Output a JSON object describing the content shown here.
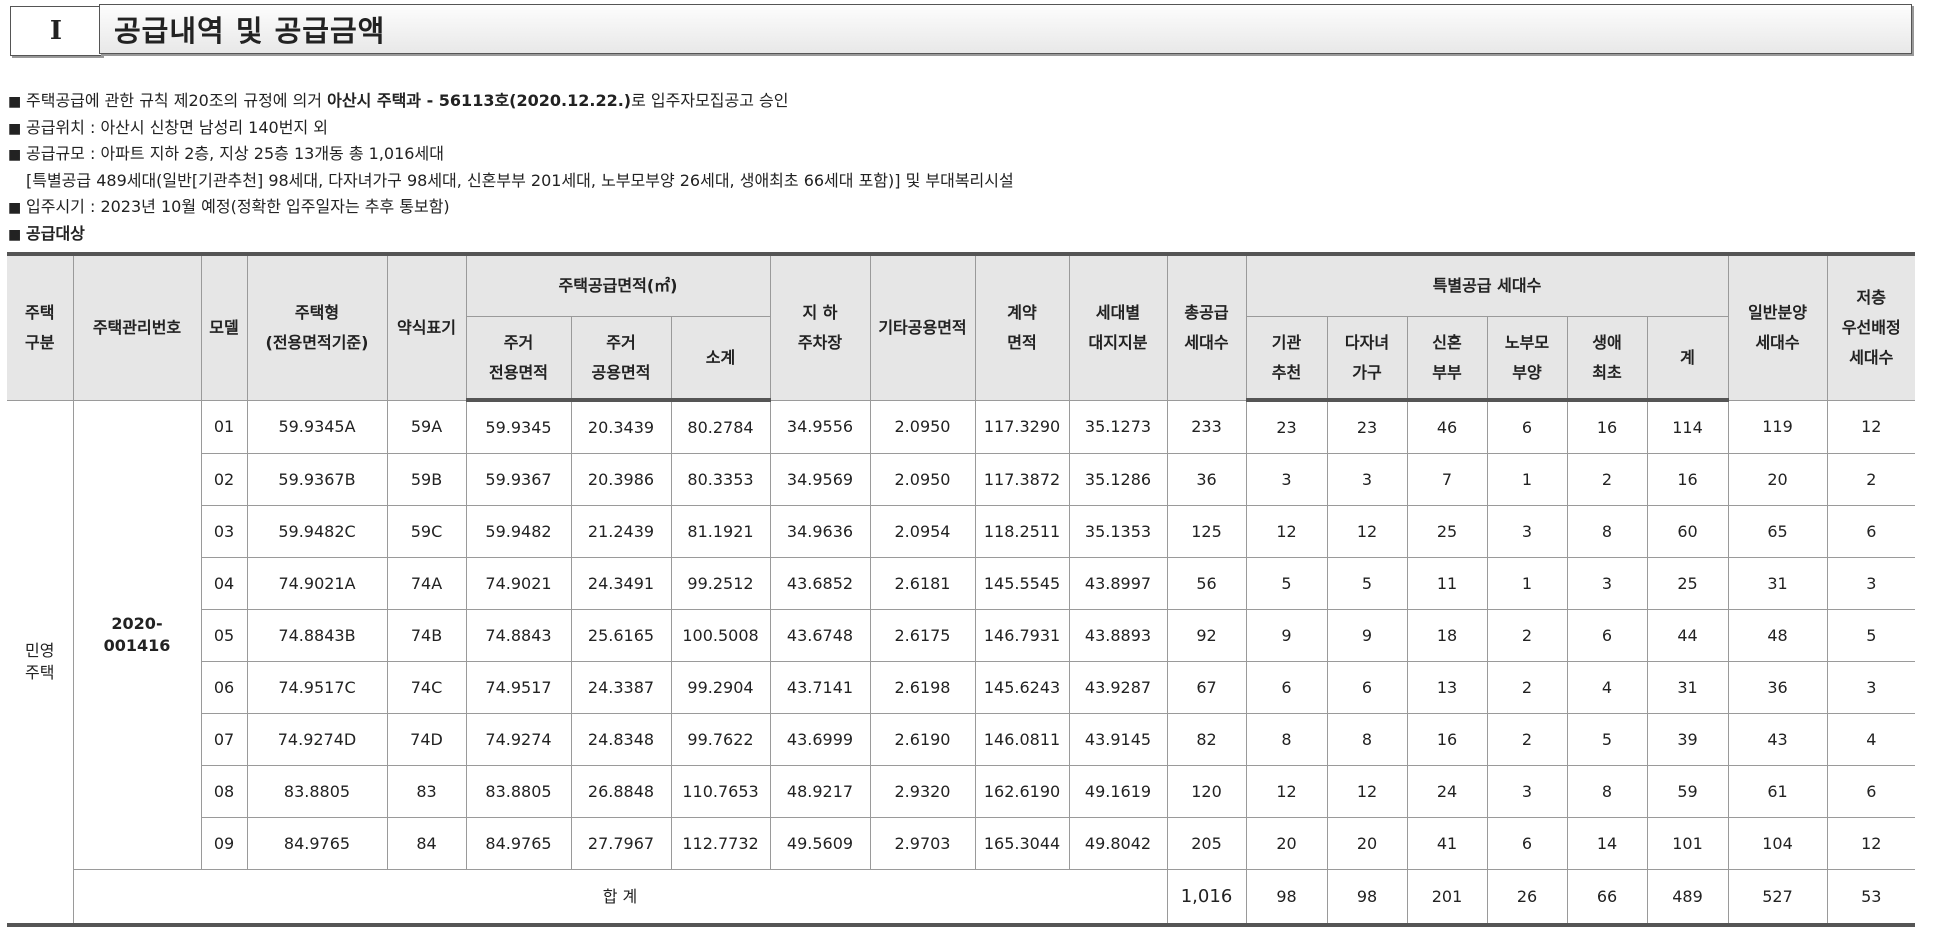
{
  "section": {
    "number": "I",
    "title": "공급내역 및 공급금액"
  },
  "notes": {
    "l1_a": "주택공급에 관한 규칙 제20조의 규정에 의거 ",
    "l1_b": "아산시 주택과 - 56113호(2020.12.22.)",
    "l1_c": "로 입주자모집공고 승인",
    "l2": "공급위치 : 아산시 신창면 남성리 140번지 외",
    "l3": "공급규모 : 아파트 지하 2층, 지상 25층 13개동 총 1,016세대",
    "l4": "[특별공급 489세대(일반[기관추천] 98세대, 다자녀가구 98세대, 신혼부부 201세대, 노부모부양 26세대, 생애최초 66세대 포함)] 및 부대복리시설",
    "l5": "입주시기 : 2023년 10월 예정(정확한 입주일자는 추후 통보함)",
    "l6": "공급대상",
    "bullet": "■"
  },
  "table": {
    "headers": {
      "housing_type": "주택\n구분",
      "mgmt_no": "주택관리번호",
      "model": "모델",
      "house_type": "주택형\n(전용면적기준)",
      "abbr": "약식표기",
      "supply_area": "주택공급면적(㎡)",
      "exclusive": "주거\n전용면적",
      "common": "주거\n공용면적",
      "subtotal": "소계",
      "parking": "지  하\n주차장",
      "other_common": "기타공용면적",
      "contract_area": "계약\n면적",
      "land_share": "세대별\n대지지분",
      "total_units": "총공급\n세대수",
      "special": "특별공급 세대수",
      "sp_inst": "기관\n추천",
      "sp_multi": "다자녀\n가구",
      "sp_newlywed": "신혼\n부부",
      "sp_elderly": "노부모\n부양",
      "sp_first": "생애\n최초",
      "sp_sum": "계",
      "general": "일반분양\n세대수",
      "low_floor": "저층\n우선배정\n세대수"
    },
    "housing_type_value": "민영\n주택",
    "mgmt_no_value": "2020-\n001416",
    "rows": [
      [
        "01",
        "59.9345A",
        "59A",
        "59.9345",
        "20.3439",
        "80.2784",
        "34.9556",
        "2.0950",
        "117.3290",
        "35.1273",
        "233",
        "23",
        "23",
        "46",
        "6",
        "16",
        "114",
        "119",
        "12"
      ],
      [
        "02",
        "59.9367B",
        "59B",
        "59.9367",
        "20.3986",
        "80.3353",
        "34.9569",
        "2.0950",
        "117.3872",
        "35.1286",
        "36",
        "3",
        "3",
        "7",
        "1",
        "2",
        "16",
        "20",
        "2"
      ],
      [
        "03",
        "59.9482C",
        "59C",
        "59.9482",
        "21.2439",
        "81.1921",
        "34.9636",
        "2.0954",
        "118.2511",
        "35.1353",
        "125",
        "12",
        "12",
        "25",
        "3",
        "8",
        "60",
        "65",
        "6"
      ],
      [
        "04",
        "74.9021A",
        "74A",
        "74.9021",
        "24.3491",
        "99.2512",
        "43.6852",
        "2.6181",
        "145.5545",
        "43.8997",
        "56",
        "5",
        "5",
        "11",
        "1",
        "3",
        "25",
        "31",
        "3"
      ],
      [
        "05",
        "74.8843B",
        "74B",
        "74.8843",
        "25.6165",
        "100.5008",
        "43.6748",
        "2.6175",
        "146.7931",
        "43.8893",
        "92",
        "9",
        "9",
        "18",
        "2",
        "6",
        "44",
        "48",
        "5"
      ],
      [
        "06",
        "74.9517C",
        "74C",
        "74.9517",
        "24.3387",
        "99.2904",
        "43.7141",
        "2.6198",
        "145.6243",
        "43.9287",
        "67",
        "6",
        "6",
        "13",
        "2",
        "4",
        "31",
        "36",
        "3"
      ],
      [
        "07",
        "74.9274D",
        "74D",
        "74.9274",
        "24.8348",
        "99.7622",
        "43.6999",
        "2.6190",
        "146.0811",
        "43.9145",
        "82",
        "8",
        "8",
        "16",
        "2",
        "5",
        "39",
        "43",
        "4"
      ],
      [
        "08",
        "83.8805",
        "83",
        "83.8805",
        "26.8848",
        "110.7653",
        "48.9217",
        "2.9320",
        "162.6190",
        "49.1619",
        "120",
        "12",
        "12",
        "24",
        "3",
        "8",
        "59",
        "61",
        "6"
      ],
      [
        "09",
        "84.9765",
        "84",
        "84.9765",
        "27.7967",
        "112.7732",
        "49.5609",
        "2.9703",
        "165.3044",
        "49.8042",
        "205",
        "20",
        "20",
        "41",
        "6",
        "14",
        "101",
        "104",
        "12"
      ]
    ],
    "total": {
      "label": "합 계",
      "values": [
        "1,016",
        "98",
        "98",
        "201",
        "26",
        "66",
        "489",
        "527",
        "53"
      ]
    }
  }
}
